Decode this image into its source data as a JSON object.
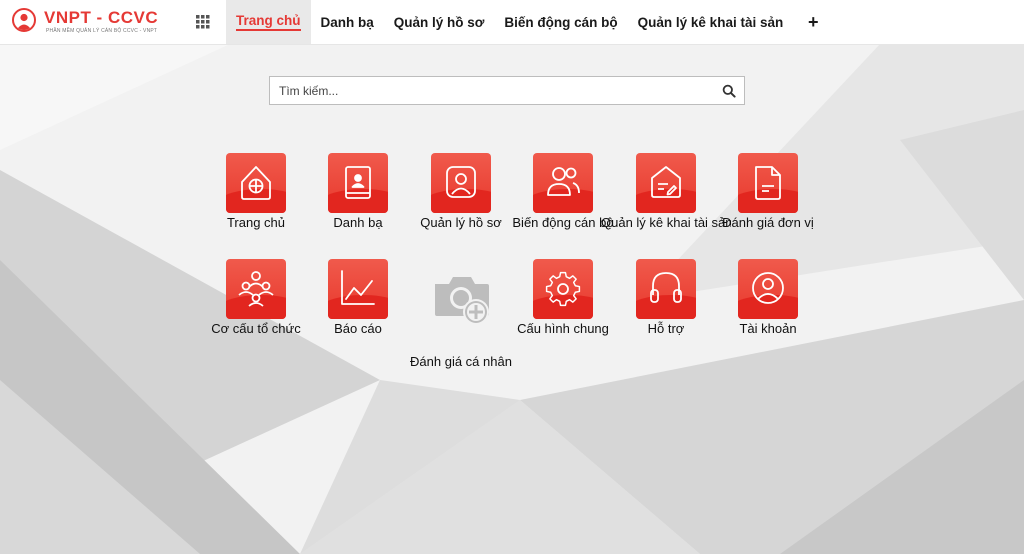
{
  "app": {
    "logo_title": "VNPT - CCVC",
    "logo_subtitle": "PHẦN MỀM QUẢN LÝ CÁN BỘ CCVC - VNPT"
  },
  "nav": {
    "items": [
      {
        "label": "Trang chủ",
        "active": true
      },
      {
        "label": "Danh bạ"
      },
      {
        "label": "Quản lý hồ sơ"
      },
      {
        "label": "Biến động cán bộ"
      },
      {
        "label": "Quản lý kê khai tài sản"
      }
    ],
    "add_label": "+"
  },
  "search": {
    "placeholder": "Tìm kiếm...",
    "value": ""
  },
  "tiles": [
    {
      "label": "Trang chủ",
      "icon": "home-icon"
    },
    {
      "label": "Danh bạ",
      "icon": "contacts-book-icon"
    },
    {
      "label": "Quản lý hồ sơ",
      "icon": "profile-icon"
    },
    {
      "label": "Biến động cán bộ",
      "icon": "users-icon"
    },
    {
      "label": "Quản lý kê khai tài sản",
      "icon": "declaration-icon"
    },
    {
      "label": "Đánh giá đơn vị",
      "icon": "document-icon"
    },
    {
      "label": "Cơ cấu tổ chức",
      "icon": "organization-icon"
    },
    {
      "label": "Báo cáo",
      "icon": "chart-icon"
    },
    {
      "label": "Đánh giá cá nhân",
      "icon": "camera-add-icon"
    },
    {
      "label": "Cấu hình chung",
      "icon": "settings-icon"
    },
    {
      "label": "Hỗ trợ",
      "icon": "headphones-icon"
    },
    {
      "label": "Tài khoản",
      "icon": "account-icon"
    }
  ],
  "colors": {
    "brand": "#e53935",
    "tile_gradient_top": "#f05a4c",
    "tile_gradient_bottom": "#e2261f",
    "camera_icon": "#bdbdbd"
  }
}
